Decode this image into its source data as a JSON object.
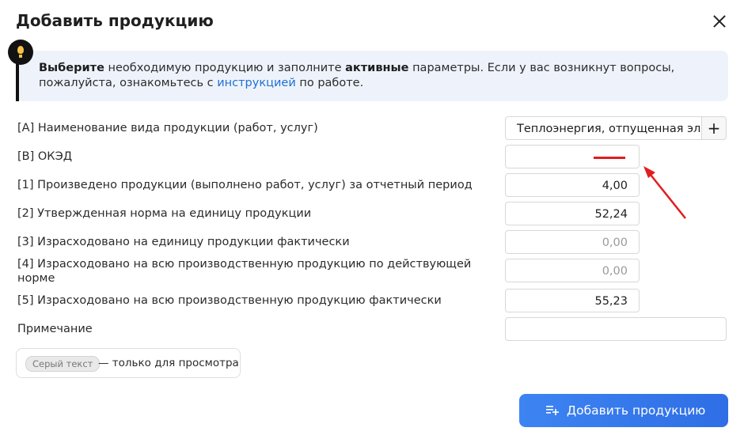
{
  "dialog": {
    "title": "Добавить продукцию",
    "info": {
      "strong1": "Выберите",
      "text1": " необходимую продукцию и заполните ",
      "strong2": "активные",
      "text2": " параметры. Если у вас возникнут вопросы, пожалуйста, ознакомьтесь с ",
      "link": "инструкцией",
      "text3": " по работе."
    },
    "rows": [
      {
        "label": "[A] Наименование вида продукции (работ, услуг)",
        "value": "Теплоэнергия, отпущенная эле..."
      },
      {
        "label": "[B] ОКЭД",
        "value": ""
      },
      {
        "label": "[1] Произведено продукции (выполнено работ, услуг) за отчетный период",
        "value": "4,00"
      },
      {
        "label": "[2] Утвержденная норма на единицу продукции",
        "value": "52,24"
      },
      {
        "label": "[3] Израсходовано на единицу продукции фактически",
        "value": "0,00"
      },
      {
        "label": "[4] Израсходовано на всю производственную продукцию по действующей норме",
        "value": "0,00"
      },
      {
        "label": "[5] Израсходовано на всю производственную продукцию фактически",
        "value": "55,23"
      },
      {
        "label": "Примечание",
        "value": ""
      }
    ],
    "legend": {
      "pill": "Серый текст",
      "text": "— только для просмотра"
    },
    "add_button": "Добавить продукцию",
    "plus": "+"
  },
  "colors": {
    "accent": "#2f6ee5",
    "link": "#1f6fd6",
    "annotation": "#e21d1d",
    "info_bg": "#eef3fb"
  },
  "icons": [
    "close-icon",
    "lightbulb-icon",
    "plus-icon",
    "playlist-add-icon",
    "annotation-arrow"
  ]
}
